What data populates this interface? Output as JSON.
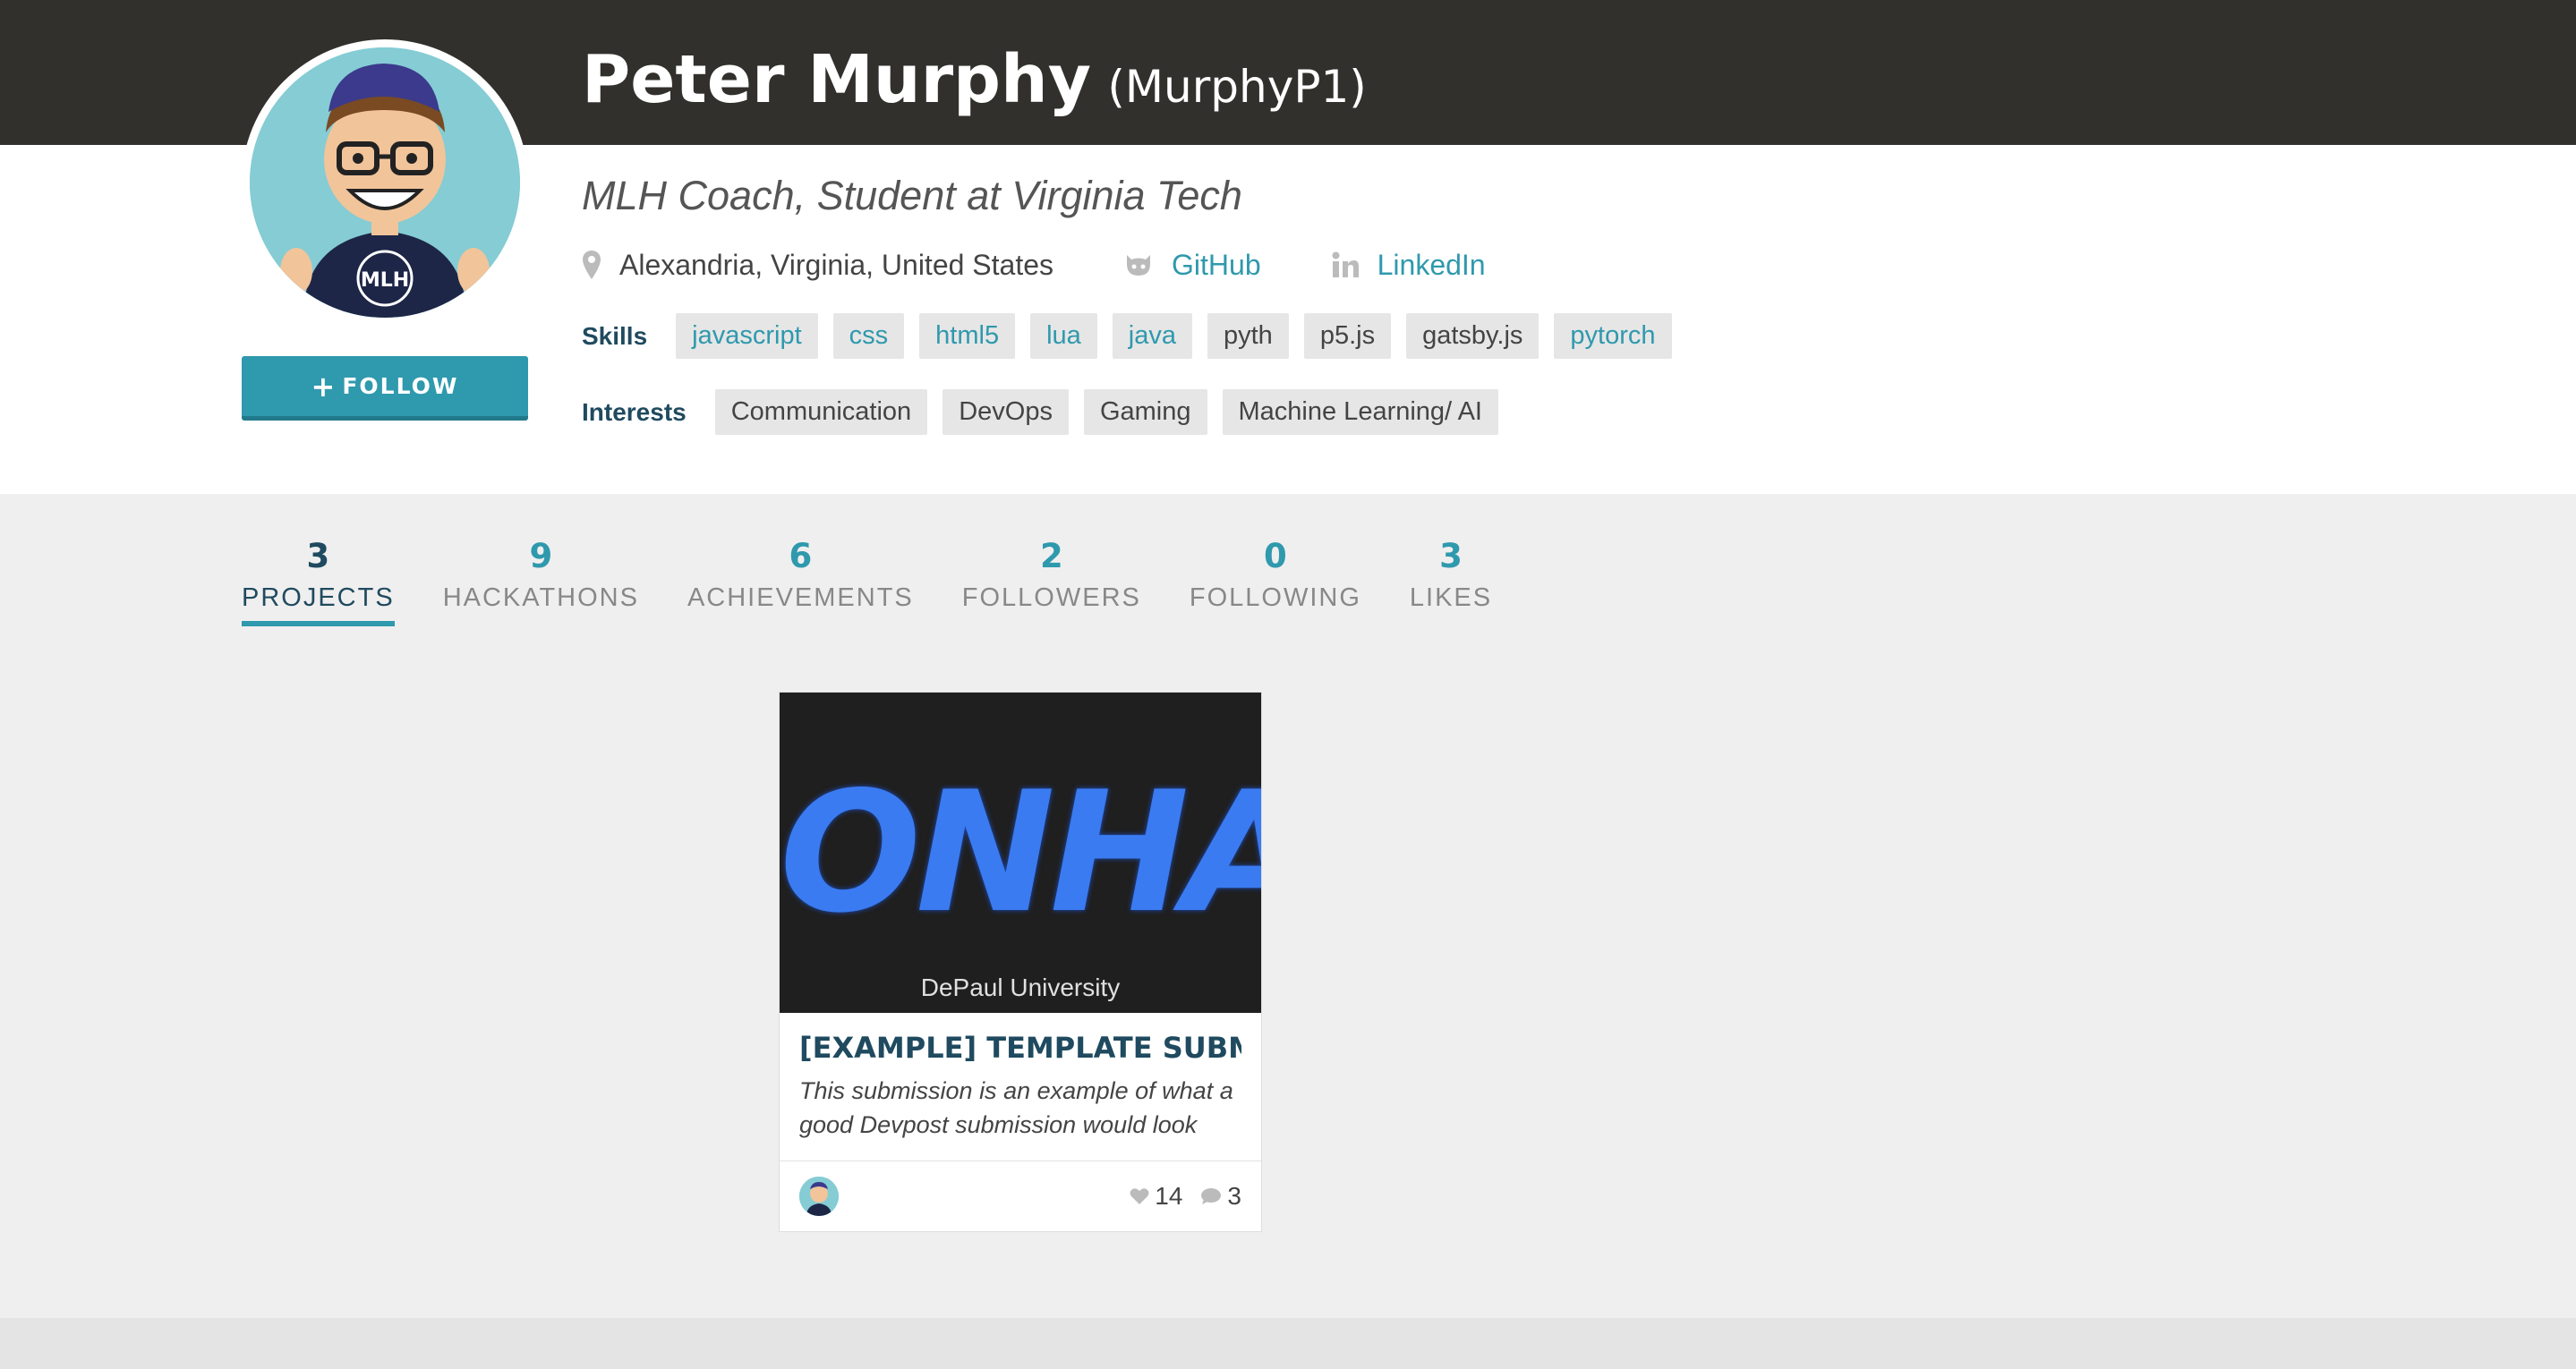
{
  "profile": {
    "name": "Peter Murphy",
    "handle": "(MurphyP1)",
    "bio": "MLH Coach, Student at Virginia Tech",
    "location": "Alexandria, Virginia, United States",
    "github_label": "GitHub",
    "linkedin_label": "LinkedIn",
    "follow_label": "FOLLOW",
    "avatar_icon": "avatar-illustration"
  },
  "skills": {
    "label": "Skills",
    "items": [
      "javascript",
      "css",
      "html5",
      "lua",
      "java",
      "pyth",
      "p5.js",
      "gatsby.js",
      "pytorch"
    ]
  },
  "interests": {
    "label": "Interests",
    "items": [
      "Communication",
      "DevOps",
      "Gaming",
      "Machine Learning/ AI"
    ]
  },
  "stats": [
    {
      "num": "3",
      "label": "PROJECTS"
    },
    {
      "num": "9",
      "label": "HACKATHONS"
    },
    {
      "num": "6",
      "label": "ACHIEVEMENTS"
    },
    {
      "num": "2",
      "label": "FOLLOWERS"
    },
    {
      "num": "0",
      "label": "FOLLOWING"
    },
    {
      "num": "3",
      "label": "LIKES"
    }
  ],
  "project": {
    "thumb_text": "ONHA",
    "thumb_caption": "DePaul University",
    "title": "[EXAMPLE] TEMPLATE SUBMI",
    "description": "This submission is an example of what a good Devpost submission would look",
    "likes": "14",
    "comments": "3"
  },
  "colors": {
    "accent": "#2f99ad",
    "header": "#32302c",
    "dark_text": "#1f4a5f"
  }
}
